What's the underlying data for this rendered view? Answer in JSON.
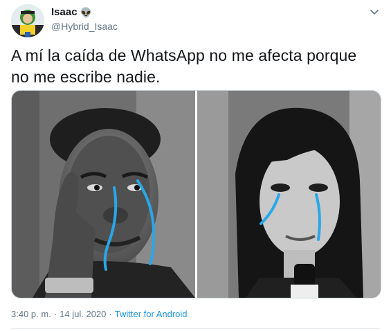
{
  "author": {
    "display_name": "Isaac",
    "name_emoji": "👽",
    "handle": "@Hybrid_Isaac"
  },
  "tweet": {
    "text": "A mí la caída de WhatsApp no me afecta porque no me escribe nadie."
  },
  "media": {
    "images": [
      "left-meme-photo",
      "right-meme-photo"
    ]
  },
  "meta": {
    "time": "3:40 p. m.",
    "separator": "·",
    "date": "14 jul. 2020",
    "source": "Twitter for Android"
  },
  "colors": {
    "text": "#14171a",
    "secondary": "#657786",
    "link": "#1b95e0",
    "tears": "#29a7e8"
  },
  "icons": {
    "menu": "chevron-down-icon",
    "verified": "alien-emoji"
  }
}
